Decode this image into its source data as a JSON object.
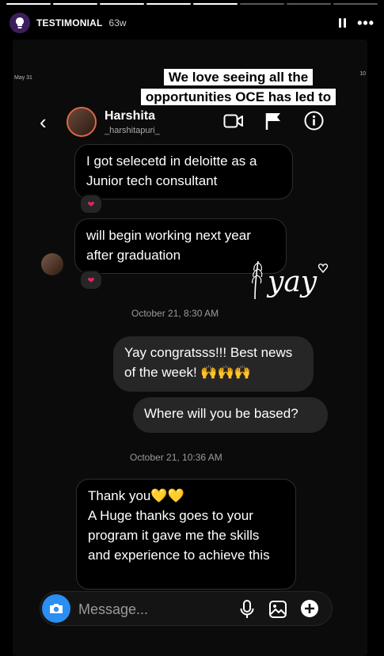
{
  "story": {
    "account_name": "TESTIMONIAL",
    "time_ago": "63w",
    "progress_segments_total": 8,
    "progress_segments_done": 5
  },
  "status_bar": {
    "date": "May 31",
    "right": "10"
  },
  "caption": {
    "line1": "We love seeing all the",
    "line2": "opportunities OCE has led to"
  },
  "chat": {
    "contact_name": "Harshita",
    "contact_username": "_harshitapuri_",
    "messages": [
      {
        "text": "I got selecetd in deloitte as a Junior tech consultant",
        "reaction": "❤"
      },
      {
        "text": "will begin working next year after graduation",
        "reaction": "❤"
      }
    ],
    "sticker_text": "yay",
    "timestamp_1": "October 21, 8:30 AM",
    "sent": [
      {
        "text": "Yay congratsss!!! Best news of the week! 🙌🙌🙌"
      },
      {
        "text": "Where will you be based?"
      }
    ],
    "timestamp_2": "October 21, 10:36 AM",
    "reply": {
      "text": "Thank you💛💛\nA Huge thanks goes to your program it gave me the skills and experience to achieve this"
    }
  },
  "composer": {
    "placeholder": "Message..."
  },
  "colors": {
    "accent": "#2a8ef3",
    "heart": "#e0245e",
    "bubble_sent": "#262626",
    "bubble_received": "#000000"
  }
}
